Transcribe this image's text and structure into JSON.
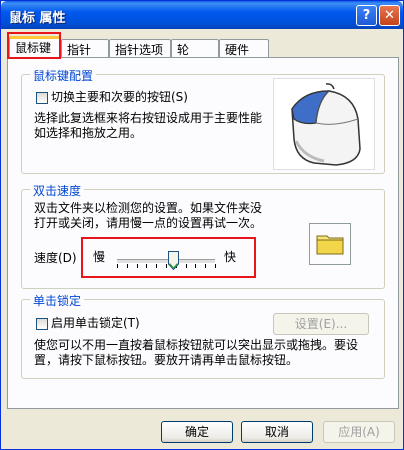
{
  "window": {
    "title": "鼠标 属性"
  },
  "titlebar_buttons": {
    "help": "?",
    "close": "✕"
  },
  "tabs": [
    {
      "label": "鼠标键"
    },
    {
      "label": "指针"
    },
    {
      "label": "指针选项"
    },
    {
      "label": "轮"
    },
    {
      "label": "硬件"
    }
  ],
  "buttons_config": {
    "group_label": "鼠标键配置",
    "swap_label": "切换主要和次要的按钮(S)",
    "swap_checked": false,
    "description": [
      "选择此复选框来将右按钮设成用于主要性能",
      "如选择和拖放之用。"
    ]
  },
  "double_click": {
    "group_label": "双击速度",
    "description": [
      "双击文件夹以检测您的设置。如果文件夹没",
      "打开或关闭，请用慢一点的设置再试一次。"
    ],
    "speed_label": "速度(D)",
    "slow_label": "慢",
    "fast_label": "快",
    "speed_value": 0.58
  },
  "click_lock": {
    "group_label": "单击锁定",
    "enable_label": "启用单击锁定(T)",
    "enable_checked": false,
    "settings_button": "设置(E)...",
    "description": [
      "使您可以不用一直按着鼠标按钮就可以突出显示或拖拽。要设",
      "置，请按下鼠标按钮。要放开请再单击鼠标按钮。"
    ]
  },
  "footer": {
    "ok": "确定",
    "cancel": "取消",
    "apply": "应用(A)"
  }
}
